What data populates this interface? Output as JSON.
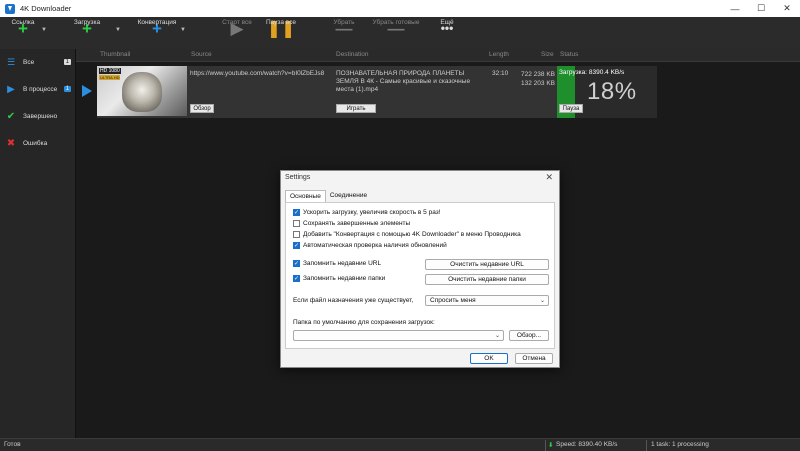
{
  "window": {
    "title": "4K Downloader",
    "minimize": "—",
    "maximize": "☐",
    "close": "✕"
  },
  "toolbar": {
    "link": "Ссылка",
    "download": "Загрузка",
    "convert": "Конвертация",
    "start_all": "Старт все",
    "pause_all": "Пауза все",
    "remove": "Убрать",
    "remove_done": "Убрать готовые",
    "more": "Ещё"
  },
  "sidebar": {
    "items": [
      {
        "label": "Все",
        "count": "1"
      },
      {
        "label": "В процессе",
        "count": "1"
      },
      {
        "label": "Завершено"
      },
      {
        "label": "Ошибка"
      }
    ]
  },
  "columns": {
    "thumbnail": "Thumbnail",
    "source": "Source",
    "destination": "Destination",
    "length": "Length",
    "size": "Size",
    "status": "Status"
  },
  "download": {
    "thumb_badge_1": "HD 1080",
    "thumb_badge_2": "ULTRA HD",
    "source": "https://www.youtube.com/watch?v=bI0lZbEJs8",
    "browse": "Обзор",
    "destination": "ПОЗНАВАТЕЛЬНАЯ ПРИРОДА ПЛАНЕТЫ ЗЕМЛЯ В 4К - Самые красивые и сказочные места (1).mp4",
    "play": "Играть",
    "length": "32:10",
    "size_total": "722 238 KB",
    "size_done": "132 203 KB",
    "speed": "Загрузка: 8390.4 KB/s",
    "percent": "18%",
    "progress": 0.18,
    "pause": "Пауза"
  },
  "statusbar": {
    "ready": "Готов",
    "speed": "Speed: 8390.40 KB/s",
    "tasks": "1 task: 1 processing"
  },
  "settings": {
    "title": "Settings",
    "tab_main": "Основные",
    "tab_connection": "Соединение",
    "opt_speed": "Ускорить загрузку, увеличив скорость в 5 раз!",
    "opt_keep_done": "Сохранять завершенные элементы",
    "opt_context": "Добавить \"Конвертация с помощью 4K Downloader\" в меню Проводника",
    "opt_updates": "Автоматическая проверка наличия обновлений",
    "opt_remember_url": "Запомнить недавние URL",
    "opt_remember_folders": "Запомнить недавние папки",
    "clear_urls": "Очистить недавние URL",
    "clear_folders": "Очистить недавние папки",
    "file_exists_label": "Если файл назначения уже существует,",
    "file_exists_value": "Спросить меня",
    "folder_label": "Папка по умолчанию для сохранения загрузок:",
    "folder_value": "",
    "browse": "Обзор...",
    "ok": "OK",
    "cancel": "Отмена"
  }
}
